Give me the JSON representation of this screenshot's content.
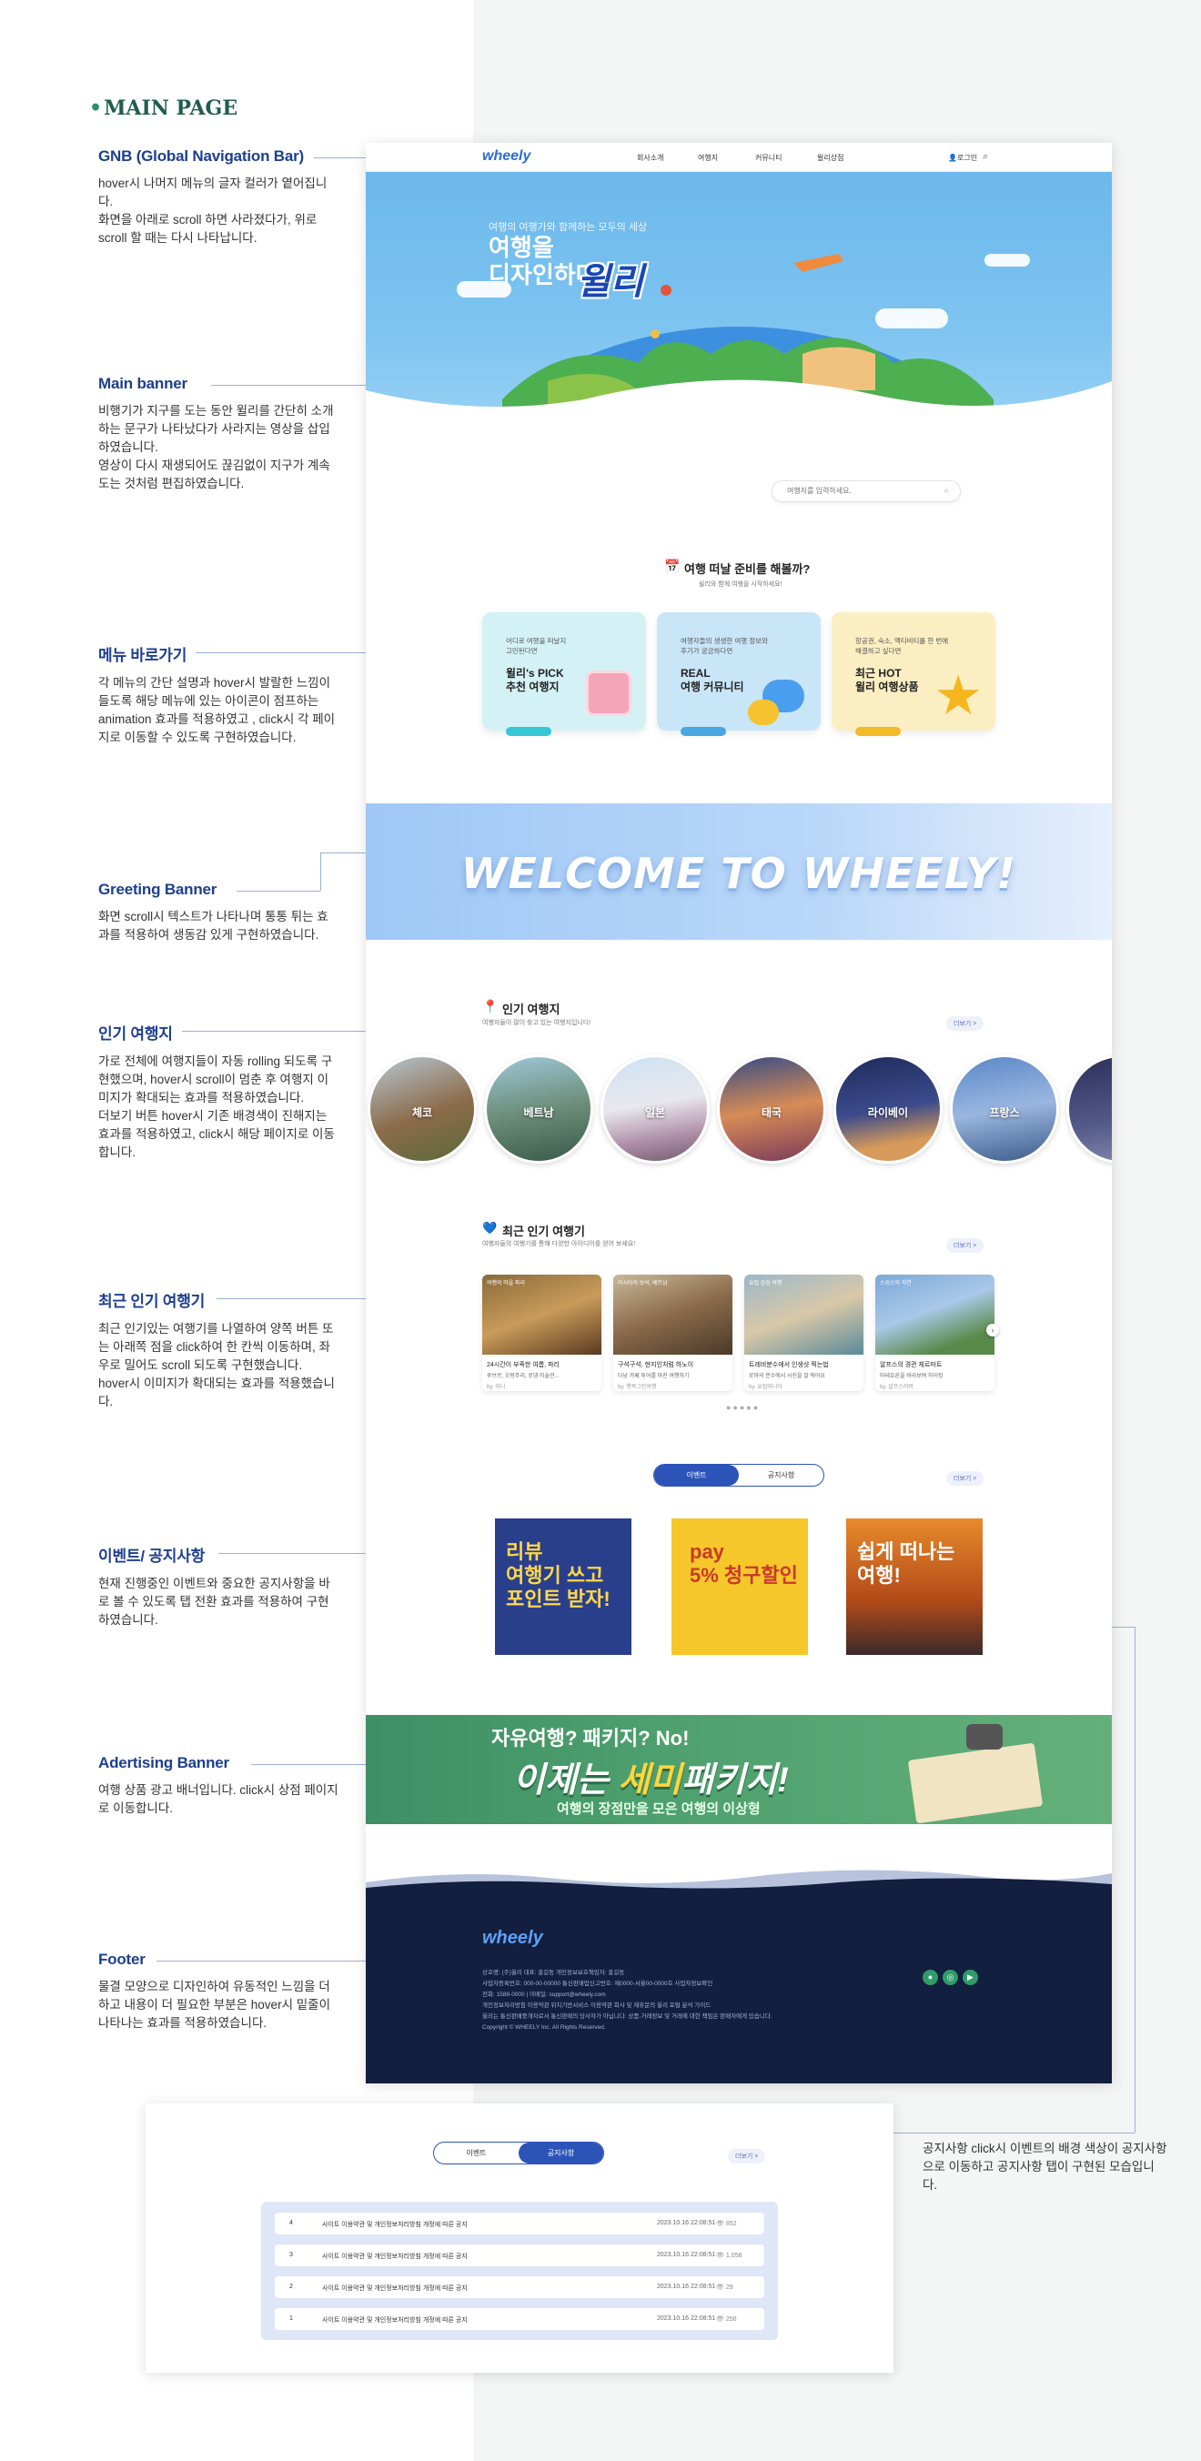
{
  "page_title": "MAIN PAGE",
  "annotations": [
    {
      "id": "gnb",
      "title": "GNB (Global Navigation Bar)",
      "text": "hover시 나머지 메뉴의 글자 컬러가 옅어집니다.\n화면을 아래로 scroll 하면 사라졌다가, 위로 scroll 할 때는 다시 나타납니다."
    },
    {
      "id": "main-banner",
      "title": "Main banner",
      "text": "비행기가 지구를 도는 동안 윌리를 간단히 소개하는 문구가 나타났다가 사라지는 영상을 삽입하였습니다.\n영상이 다시 재생되어도 끊김없이 지구가 계속 도는 것처럼 편집하였습니다."
    },
    {
      "id": "menu-shortcut",
      "title": "메뉴 바로가기",
      "text": "각 메뉴의 간단 설명과 hover시 발랄한 느낌이 들도록 해당 메뉴에 있는 아이콘이 점프하는 animation 효과를 적용하였고 , click시 각 페이지로 이동할 수 있도록 구현하였습니다."
    },
    {
      "id": "greeting",
      "title": "Greeting Banner",
      "text": "화면 scroll시 텍스트가 나타나며 통통 튀는 효과를 적용하여 생동감 있게 구현하였습니다."
    },
    {
      "id": "popular",
      "title": "인기 여행지",
      "text": "가로 전체에 여행지들이 자동 rolling 되도록 구현했으며, hover시 scroll이 멈춘 후 여행지 이미지가 확대되는 효과를 적용하였습니다.\n더보기 버튼 hover시 기존 배경색이 진해지는 효과를 적용하였고, click시 해당 페이지로 이동합니다."
    },
    {
      "id": "recent",
      "title": "최근 인기 여행기",
      "text": "최근 인기있는 여행기를 나열하여 양쪽 버튼 또는 아래쪽 점을 click하여 한 칸씩 이동하며, 좌우로 밀어도 scroll 되도록 구현했습니다.\nhover시 이미지가 확대되는 효과를 적용했습니다."
    },
    {
      "id": "event",
      "title": "이벤트/ 공지사항",
      "text": "현재 진행중인 이벤트와 중요한 공지사항을 바로 볼 수 있도록 탭 전환 효과를 적용하여 구현하였습니다."
    },
    {
      "id": "ad",
      "title": "Adertising Banner",
      "text": "여행 상품 광고 배너입니다. click시 상점 페이지로 이동합니다."
    },
    {
      "id": "footer",
      "title": "Footer",
      "text": "물결 모양으로 디자인하여 유동적인 느낌을 더하고 내용이 더 필요한 부분은 hover시 밑줄이 나타나는 효과를 적용하였습니다."
    }
  ],
  "side_note": "공지사항 click시 이벤트의 배경 색상이 공지사항으로 이동하고 공지사항 탭이 구현된 모습입니다.",
  "site": {
    "logo": "wheely",
    "gnb": {
      "menu": [
        "회사소개",
        "여행지",
        "커뮤니티",
        "윌리상점"
      ],
      "login": "로그인",
      "search_icon": "search-icon"
    },
    "banner": {
      "tagline": "여행의 여행가와 함께하는 모두의 세상",
      "headline": "여행을\n디자인하다,",
      "brand": "윌리"
    },
    "search": {
      "placeholder": "여행지를 입력하세요."
    },
    "prep": {
      "title": "여행 떠날 준비를 해볼까?",
      "subtitle": "윌리와 함께 여행을 시작하세요!"
    },
    "cards": [
      {
        "desc": "어디로 여행을 떠날지\n고민된다면",
        "name": "윌리's PICK\n추천 여행지",
        "color": "#d4f2f5",
        "accent": "#37c6d4",
        "icon": "gift-box-icon"
      },
      {
        "desc": "여행자들의 생생한 여행 정보와\n후기가 궁금하다면",
        "name": "REAL\n여행 커뮤니티",
        "color": "#c9e5f8",
        "accent": "#4aa7e3",
        "icon": "chat-bubble-icon"
      },
      {
        "desc": "항공권, 숙소, 액티비티를 한 번에\n해결하고 싶다면",
        "name": "최근 HOT\n윌리 여행상품",
        "color": "#fbeec2",
        "accent": "#f2bb27",
        "icon": "star-icon"
      }
    ],
    "greeting": "WELCOME TO WHEELY!",
    "popular": {
      "title": "인기 여행지",
      "subtitle": "여행자들이 많이 찾고 있는 여행지입니다!",
      "more": "더보기 >",
      "items": [
        {
          "name": "체코",
          "bg": "linear-gradient(160deg,#b7c8d4,#8c6b4a 55%,#5b6a3a)"
        },
        {
          "name": "베트남",
          "bg": "linear-gradient(170deg,#9fc7d9,#6d8f7b 50%,#3a5a4a)"
        },
        {
          "name": "일본",
          "bg": "linear-gradient(170deg,#cfe2f2,#e8e8ee 45%,#b08fa8 75%,#6e5a70)"
        },
        {
          "name": "태국",
          "bg": "linear-gradient(170deg,#364b86,#d78c56 50%,#7a3a5a)"
        },
        {
          "name": "라이베이",
          "bg": "linear-gradient(170deg,#1f2b5c,#3b4b8c 50%,#d89a5a 80%)"
        },
        {
          "name": "프랑스",
          "bg": "linear-gradient(170deg,#5a88c8,#9ab6e0 50%,#3b5b8a)"
        },
        {
          "name": "",
          "bg": "linear-gradient(170deg,#2d2f5a,#545a8a 60%,#8a8ab0)"
        }
      ]
    },
    "recent": {
      "title": "최근 인기 여행기",
      "subtitle": "여행자들의 여행기를 통해 다양한 아이디어를 얻어 보세요!",
      "more": "더보기 >",
      "items": [
        {
          "tag": "여행의 마을 파리",
          "title": "24시간이 부족한 여름, 파리",
          "sub": "루브르, 오랑주리, 로댕 미술관...",
          "by": "by. 하니",
          "bg": "linear-gradient(160deg,#8a6a3a,#c99b5a 50%,#5a3a20)"
        },
        {
          "tag": "아시아의 보석, 베트남",
          "title": "구석구석, 현지인처럼 하노이",
          "sub": "다낭 카페 투어를 마친 여행하기",
          "by": "by. 행복그린여행",
          "bg": "linear-gradient(160deg,#c9b89a,#8a6a4a 50%,#4a3a2a)"
        },
        {
          "tag": "유럽 감성 여행",
          "title": "트레비분수에서 인생샷 찍는법",
          "sub": "로마의 분수에서 사진을 잘 찍어요",
          "by": "by. 유럽마니아",
          "bg": "linear-gradient(160deg,#9ab8c9,#d9c8a8 50%,#5a8a9a)"
        },
        {
          "tag": "스위스의 자연",
          "title": "알프스의 경관 체르마트",
          "sub": "마테호른을 바라보며 하이킹",
          "by": "by. 알프스러버",
          "bg": "linear-gradient(160deg,#7aa8d8,#aac8e8 45%,#5a8a4a 80%)"
        }
      ],
      "dots": "●●●●●"
    },
    "tabs": {
      "event": "이벤트",
      "notice": "공지사항",
      "more": "더보기 >"
    },
    "events": [
      {
        "text": "리뷰\n여행기 쓰고\n포인트 받자!",
        "bg": "#2a3f8c"
      },
      {
        "text": "pay\n5% 청구할인",
        "bg": "#f5c72a"
      },
      {
        "text": "쉽게 떠나는\n여행!",
        "bg": "#d8671f"
      }
    ],
    "ad": {
      "line1": "자유여행? 패키지? No!",
      "line2_pre": "이제는 ",
      "line2_hl": "세미",
      "line2_post": "패키지!",
      "line3": "여행의 장점만을 모은 여행의 이상형"
    },
    "footer": {
      "logo": "wheely",
      "info": "상호명: (주)윌리    대표: 홍길동    개인정보보호책임자: 홍길동\n사업자등록번호: 000-00-00000    통신판매업신고번호: 제0000-서울00-0000호    사업자정보확인\n전화: 1588-0000 | 이메일: support@wheely.com\n개인정보처리방침    이용약관    위치기반서비스 이용약관    회사 및 제휴문의    윌리 포털 분석 가이드\n윌리는 통신판매중개자로서 통신판매의 당사자가 아닙니다. 상품·거래정보 및 거래에 대한 책임은 판매자에게 있습니다.\nCopyright © WHEELY Inc. All Rights Reserved.",
      "social": [
        "chat-icon",
        "instagram-icon",
        "youtube-icon"
      ]
    }
  },
  "notice": {
    "tabs": {
      "event": "이벤트",
      "notice": "공지사항",
      "more": "더보기 >"
    },
    "rows": [
      {
        "no": "4",
        "title": "사이트 이용약관 및 개인정보처리방침 개정에 따른 공지",
        "date": "2023.10.16 22:08:51",
        "views": "852"
      },
      {
        "no": "3",
        "title": "사이트 이용약관 및 개인정보처리방침 개정에 따른 공지",
        "date": "2023.10.16 22:08:51",
        "views": "1,058"
      },
      {
        "no": "2",
        "title": "사이트 이용약관 및 개인정보처리방침 개정에 따른 공지",
        "date": "2023.10.16 22:08:51",
        "views": "29"
      },
      {
        "no": "1",
        "title": "사이트 이용약관 및 개인정보처리방침 개정에 따른 공지",
        "date": "2023.10.16 22:08:51",
        "views": "256"
      }
    ]
  }
}
